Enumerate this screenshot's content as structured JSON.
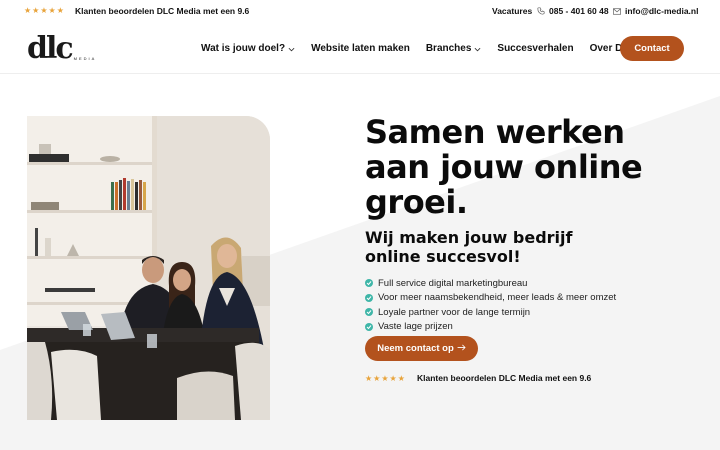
{
  "topbar": {
    "stars": "★★★★★",
    "rating_text": "Klanten beoordelen DLC Media met een 9.6",
    "vacatures": "Vacatures",
    "phone": "085 - 401 60 48",
    "email": "info@dlc-media.nl"
  },
  "logo": {
    "mark": "dlc",
    "sub": "MEDIA"
  },
  "nav": {
    "items": [
      {
        "label": "Wat is jouw doel?",
        "dropdown": true
      },
      {
        "label": "Website laten maken",
        "dropdown": false
      },
      {
        "label": "Branches",
        "dropdown": true
      },
      {
        "label": "Succesverhalen",
        "dropdown": false
      },
      {
        "label": "Over DLC Media",
        "dropdown": false
      }
    ],
    "contact_label": "Contact"
  },
  "hero": {
    "title": "Samen werken aan jouw online groei.",
    "subtitle": "Wij maken jouw bedrijf online succesvol!",
    "checks": [
      "Full service digital marketingbureau",
      "Voor meer naamsbekendheid, meer leads & meer omzet",
      "Loyale partner voor de lange termijn",
      "Vaste lage prijzen"
    ],
    "cta_label": "Neem contact op",
    "rating_stars": "★★★★★",
    "rating_text": "Klanten beoordelen DLC Media met een 9.6"
  },
  "colors": {
    "accent": "#b3521d",
    "check": "#3fb6a8",
    "stars": "#e8a33a"
  }
}
